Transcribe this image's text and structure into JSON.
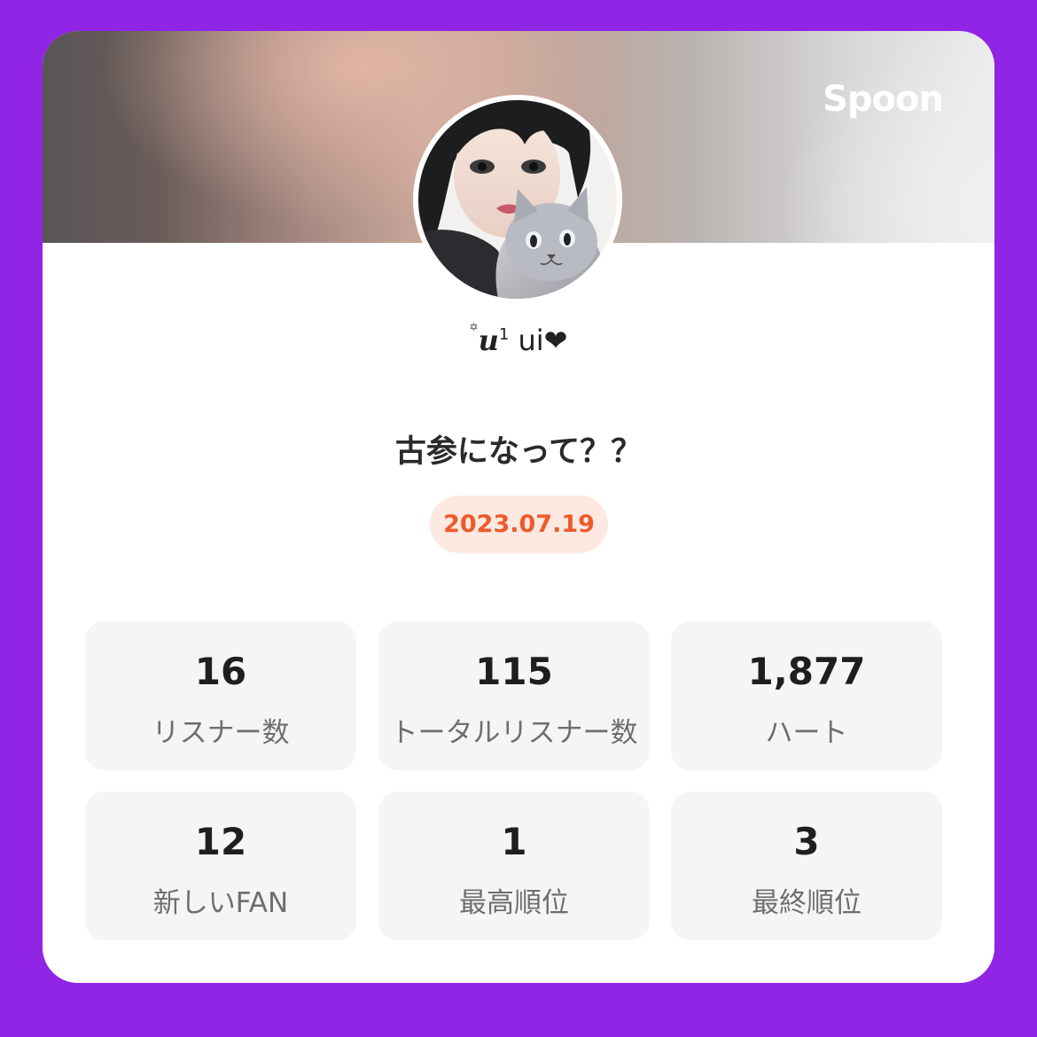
{
  "brand": {
    "name": "Spoon"
  },
  "profile": {
    "name_prefix_icon": "✡",
    "name_styled": "𝒖",
    "name_superscript": "1",
    "name_text": " ui",
    "name_heart": "❤"
  },
  "live": {
    "title": "古参になって？？",
    "date": "2023.07.19"
  },
  "stats": [
    {
      "value": "16",
      "label": "リスナー数"
    },
    {
      "value": "115",
      "label": "トータルリスナー数"
    },
    {
      "value": "1,877",
      "label": "ハート"
    },
    {
      "value": "12",
      "label": "新しいFAN"
    },
    {
      "value": "1",
      "label": "最高順位"
    },
    {
      "value": "3",
      "label": "最終順位"
    }
  ],
  "colors": {
    "background": "#9125e6",
    "date_pill_bg": "#fde9e2",
    "date_text": "#ee5a2a",
    "stat_bg": "#f5f5f5"
  }
}
